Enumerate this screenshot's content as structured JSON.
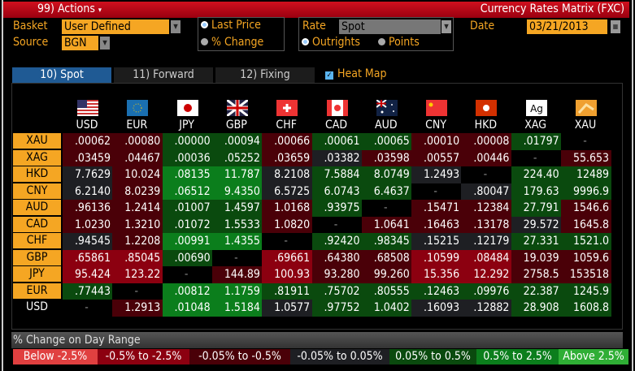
{
  "header": {
    "actions": "99) Actions",
    "actions_arrow": "▾",
    "title": "Currency Rates Matrix (FXC)"
  },
  "controls": {
    "basket_label": "Basket",
    "basket_value": "User Defined",
    "source_label": "Source",
    "source_value": "BGN",
    "price_options": [
      "Last Price",
      "% Change"
    ],
    "price_selected": 0,
    "rate_label": "Rate",
    "rate_value": "Spot",
    "rate_options": [
      "Outrights",
      "Points"
    ],
    "rate_selected": 0,
    "date_label": "Date",
    "date_value": "03/21/2013"
  },
  "tabs": [
    {
      "label": "10) Spot",
      "active": true
    },
    {
      "label": "11) Forward",
      "active": false
    },
    {
      "label": "12) Fixing",
      "active": false
    }
  ],
  "heat_map": {
    "label": "Heat Map",
    "checked": true
  },
  "columns": [
    "USD",
    "EUR",
    "JPY",
    "GBP",
    "CHF",
    "CAD",
    "AUD",
    "CNY",
    "HKD",
    "XAG",
    "XAU"
  ],
  "rows": [
    {
      "label": "XAU",
      "values": [
        ".00062",
        ".00080",
        ".00000",
        ".00094",
        ".00066",
        ".00061",
        ".00065",
        ".00010",
        ".00008",
        ".01797",
        "-"
      ],
      "heat": [
        -1,
        -1,
        1,
        1,
        -1,
        1,
        1,
        -1,
        -1,
        1,
        "x"
      ]
    },
    {
      "label": "XAG",
      "values": [
        ".03459",
        ".04467",
        ".00036",
        ".05252",
        ".03659",
        ".03382",
        ".03598",
        ".00557",
        ".00446",
        "-",
        "55.653"
      ],
      "heat": [
        -1,
        -1,
        1,
        1,
        -1,
        0,
        -1,
        -1,
        -1,
        "x",
        -1
      ]
    },
    {
      "label": "HKD",
      "values": [
        "7.7629",
        "10.024",
        ".08135",
        "11.787",
        "8.2108",
        "7.5884",
        "8.0749",
        "1.2493",
        "-",
        "224.40",
        "12489"
      ],
      "heat": [
        0,
        -1,
        2,
        2,
        0,
        1,
        1,
        0,
        "x",
        1,
        1
      ]
    },
    {
      "label": "CNY",
      "values": [
        "6.2140",
        "8.0239",
        ".06512",
        "9.4350",
        "6.5725",
        "6.0743",
        "6.4637",
        "-",
        ".80047",
        "179.63",
        "9996.9"
      ],
      "heat": [
        0,
        -1,
        2,
        2,
        0,
        1,
        1,
        "x",
        0,
        1,
        1
      ]
    },
    {
      "label": "AUD",
      "values": [
        ".96136",
        "1.2414",
        ".01007",
        "1.4597",
        "1.0168",
        ".93975",
        "-",
        ".15471",
        ".12384",
        "27.791",
        "1546.6"
      ],
      "heat": [
        -1,
        -1,
        1,
        1,
        -1,
        1,
        "x",
        -1,
        -1,
        1,
        -1
      ]
    },
    {
      "label": "CAD",
      "values": [
        "1.0230",
        "1.3210",
        ".01072",
        "1.5533",
        "1.0820",
        "-",
        "1.0641",
        ".16463",
        ".13178",
        "29.572",
        "1645.8"
      ],
      "heat": [
        -1,
        -1,
        1,
        1,
        -1,
        "x",
        -1,
        -1,
        -1,
        0,
        -1
      ]
    },
    {
      "label": "CHF",
      "values": [
        ".94545",
        "1.2208",
        ".00991",
        "1.4355",
        "-",
        ".92420",
        ".98345",
        ".15215",
        ".12179",
        "27.331",
        "1521.0"
      ],
      "heat": [
        0,
        -1,
        2,
        2,
        "x",
        1,
        1,
        0,
        0,
        1,
        1
      ]
    },
    {
      "label": "GBP",
      "values": [
        ".65861",
        ".85045",
        ".00690",
        "-",
        ".69661",
        ".64380",
        ".68508",
        ".10599",
        ".08484",
        "19.039",
        "1059.6"
      ],
      "heat": [
        -2,
        -2,
        1,
        "x",
        -2,
        -1,
        -1,
        -2,
        -2,
        -1,
        -1
      ]
    },
    {
      "label": "JPY",
      "values": [
        "95.424",
        "123.22",
        "-",
        "144.89",
        "100.93",
        "93.280",
        "99.260",
        "15.356",
        "12.292",
        "2758.5",
        "153518"
      ],
      "heat": [
        -2,
        -2,
        "x",
        -1,
        -2,
        -1,
        -1,
        -2,
        -2,
        -1,
        -1
      ]
    },
    {
      "label": "EUR",
      "values": [
        ".77443",
        "-",
        ".00812",
        "1.1759",
        ".81911",
        ".75702",
        ".80555",
        ".12463",
        ".09976",
        "22.387",
        "1245.9"
      ],
      "heat": [
        1,
        "x",
        2,
        2,
        1,
        1,
        1,
        1,
        1,
        1,
        1
      ]
    },
    {
      "label": "USD",
      "values": [
        "-",
        "1.2913",
        ".01048",
        "1.5184",
        "1.0577",
        ".97752",
        "1.0402",
        ".16093",
        ".12882",
        "28.908",
        "1608.8"
      ],
      "heat": [
        "x",
        -1,
        2,
        2,
        0,
        1,
        1,
        0,
        0,
        1,
        1
      ]
    }
  ],
  "heat_colors": {
    "-3": "#e04040",
    "-2": "#8c0010",
    "-1": "#4a0008",
    "0": "#1e1f23",
    "1": "#0a4a0e",
    "2": "#0b7e1c",
    "3": "#2fae35",
    "x": "#000000"
  },
  "legend": {
    "title": "% Change on Day Range",
    "items": [
      {
        "label": "Below -2.5%",
        "level": "-3"
      },
      {
        "label": "-0.5% to -2.5%",
        "level": "-2"
      },
      {
        "label": "-0.05% to -0.5%",
        "level": "-1"
      },
      {
        "label": "-0.05% to 0.05%",
        "level": "0"
      },
      {
        "label": "0.05% to 0.5%",
        "level": "1"
      },
      {
        "label": "0.5% to 2.5%",
        "level": "2"
      },
      {
        "label": "Above 2.5%",
        "level": "3"
      }
    ]
  }
}
